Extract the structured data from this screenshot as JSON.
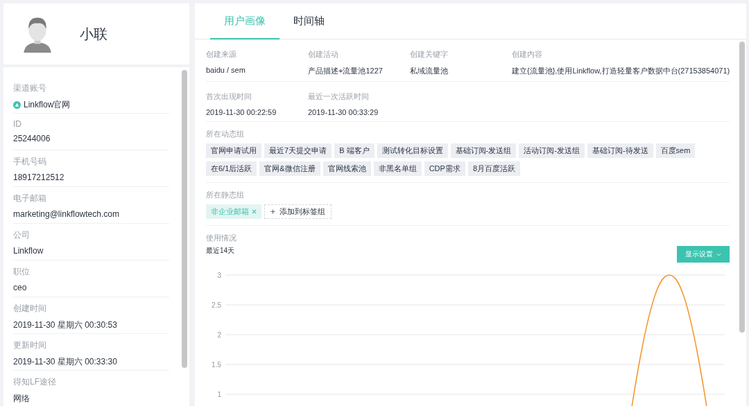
{
  "profile": {
    "name": "小联"
  },
  "info_fields": [
    {
      "label": "渠道账号",
      "value": "Linkflow官网",
      "kind": "channel"
    },
    {
      "label": "ID",
      "value": "25244006",
      "kind": "text"
    },
    {
      "label": "手机号码",
      "value": "18917212512",
      "kind": "text"
    },
    {
      "label": "电子邮箱",
      "value": "marketing@linkflowtech.com",
      "kind": "text"
    },
    {
      "label": "公司",
      "value": "Linkflow",
      "kind": "text"
    },
    {
      "label": "职位",
      "value": "ceo",
      "kind": "text"
    },
    {
      "label": "创建时间",
      "value": "2019-11-30 星期六 00:30:53",
      "kind": "text"
    },
    {
      "label": "更新时间",
      "value": "2019-11-30 星期六 00:33:30",
      "kind": "text"
    },
    {
      "label": "得知LF途径",
      "value": "网络",
      "kind": "text"
    }
  ],
  "tabs": [
    {
      "label": "用户画像",
      "selected": true
    },
    {
      "label": "时间轴",
      "selected": false
    }
  ],
  "attribute_rows": [
    [
      {
        "label": "创建来源",
        "value": "baidu / sem"
      },
      {
        "label": "创建活动",
        "value": "产品描述+流量池1227"
      },
      {
        "label": "创建关键字",
        "value": "私域流量池"
      },
      {
        "label": "创建内容",
        "value": "建立{流量池},使用Linkflow,打造轻量客户数据中台(27153854071)"
      }
    ],
    [
      {
        "label": "首次出现时间",
        "value": "2019-11-30 00:22:59"
      },
      {
        "label": "最近一次活跃时间",
        "value": "2019-11-30 00:33:29"
      }
    ]
  ],
  "dynamic_groups": {
    "label": "所在动态组",
    "tags": [
      "官网申请试用",
      "最近7天提交申请",
      "B 端客户",
      "测试转化目标设置",
      "基础订阅-发送组",
      "活动订阅-发送组",
      "基础订阅-待发送",
      "百度sem",
      "在6/1后活跃",
      "官网&微信注册",
      "官网线索池",
      "非黑名单组",
      "CDP需求",
      "8月百度活跃"
    ]
  },
  "static_groups": {
    "label": "所在静态组",
    "tags": [
      "非企业邮箱"
    ],
    "add_button": "添加到标签组"
  },
  "usage": {
    "label": "使用情况",
    "period": "最近14天",
    "settings_button": "显示设置",
    "chart_axis_labels": [
      "3",
      "2.5",
      "2",
      "1.5",
      "1"
    ]
  }
}
